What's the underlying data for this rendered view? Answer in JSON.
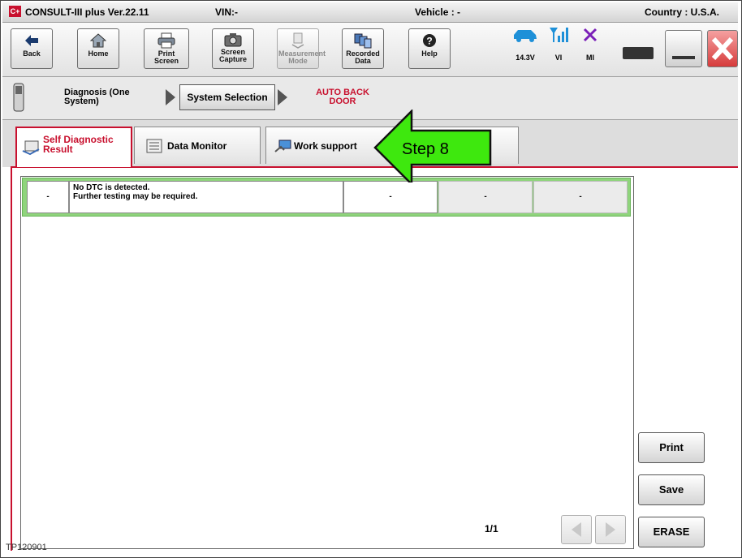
{
  "titlebar": {
    "app_logo": "C+",
    "app_title": "CONSULT-III plus  Ver.22.11",
    "vin": "VIN:-",
    "vehicle": "Vehicle : -",
    "country": "Country : U.S.A."
  },
  "toolbar": {
    "buttons": [
      {
        "label": "Back",
        "icon": "back-arrow-icon"
      },
      {
        "label": "Home",
        "icon": "home-icon"
      },
      {
        "label": "Print Screen",
        "icon": "printer-icon"
      },
      {
        "label": "Screen Capture",
        "icon": "camera-icon"
      },
      {
        "label": "Measurement Mode",
        "icon": "measurement-icon",
        "disabled": true
      },
      {
        "label": "Recorded Data",
        "icon": "recorded-data-icon"
      },
      {
        "label": "Help",
        "icon": "help-icon"
      }
    ],
    "status": {
      "voltage": "14.3V",
      "vi": "VI",
      "mi": "MI"
    }
  },
  "breadcrumb": {
    "diagnosis": "Diagnosis (One System)",
    "system_selection": "System Selection",
    "current": "AUTO BACK DOOR"
  },
  "tabs": [
    {
      "label": "Self Diagnostic Result",
      "active": true,
      "icon": "self-diagnostic-icon"
    },
    {
      "label": "Data Monitor",
      "active": false,
      "icon": "data-monitor-icon"
    },
    {
      "label": "Work support",
      "active": false,
      "icon": "work-support-icon"
    }
  ],
  "callout": {
    "label": "Step 8",
    "color": "#3ee80e"
  },
  "results": {
    "rows": [
      {
        "code": "-",
        "description_line1": "No DTC is detected.",
        "description_line2": "Further testing may be required.",
        "col3": "-",
        "col4": "-",
        "col5": "-"
      }
    ],
    "page_indicator": "1/1"
  },
  "side_buttons": {
    "print": "Print",
    "save": "Save",
    "erase": "ERASE"
  },
  "footer_ref": "TP120901",
  "colors": {
    "accent": "#c8102e",
    "row_highlight": "#8fd47c"
  }
}
